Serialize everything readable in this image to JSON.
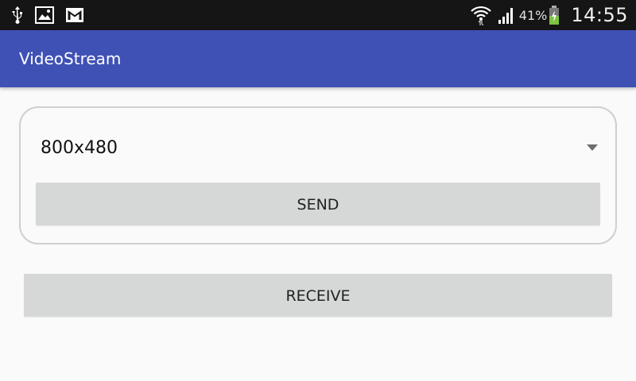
{
  "status_bar": {
    "left_icons": [
      "usb-icon",
      "image-icon",
      "gmail-icon"
    ],
    "right_icons": [
      "wifi-icon",
      "signal-icon",
      "battery-charging-icon"
    ],
    "battery_percent": "41%",
    "time": "14:55"
  },
  "app_bar": {
    "title": "VideoStream",
    "color": "#3f51b5"
  },
  "stream_panel": {
    "resolution_selected": "800x480",
    "send_label": "SEND"
  },
  "receive_label": "RECEIVE"
}
